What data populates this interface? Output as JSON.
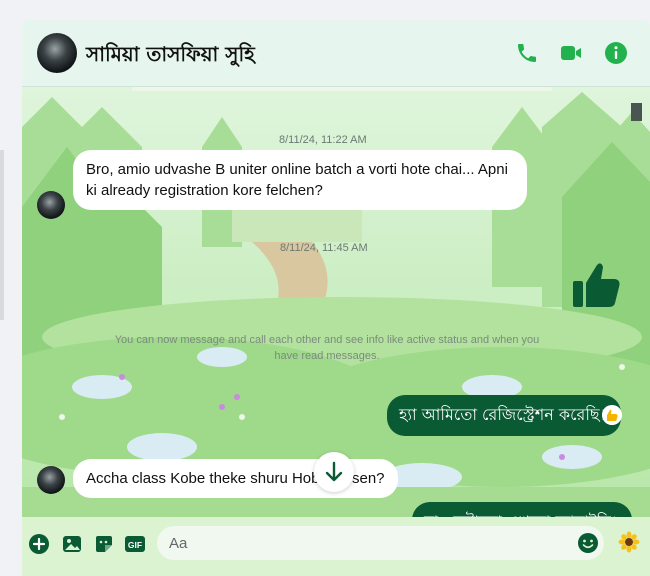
{
  "header": {
    "contact_name": "সামিয়া তাসফিয়া সুহি",
    "call_icon": "phone-icon",
    "video_icon": "video-camera-icon",
    "info_icon": "info-icon"
  },
  "messages": {
    "timestamp_1": "8/11/24, 11:22 AM",
    "incoming_1": "Bro, amio udvashe B uniter online batch a vorti hote chai... Apni ki already registration kore felchen?",
    "timestamp_2": "8/11/24, 11:45 AM",
    "outgoing_thumbs_icon": "thumbs-up-icon",
    "system_notice": "You can now message and call each other and see info like active status and when you have read messages.",
    "outgoing_1": "হ্যা আমিতো রেজিস্ট্রেশন করেছি।",
    "outgoing_1_reaction": "thumbs-up-icon",
    "incoming_2": "Accha class Kobe theke shuru Hobe jansen?",
    "outgoing_2": "না, সেটাতো এখনো জানাইনি।"
  },
  "composer": {
    "placeholder": "Aa",
    "icons": [
      "plus-circle-icon",
      "image-icon",
      "sticker-icon",
      "gif-icon",
      "emoji-icon",
      "sunflower-icon"
    ],
    "gif_label": "GIF"
  },
  "colors": {
    "accent": "#31a24c",
    "outgoing_bubble": "#0a5a34",
    "chat_background": "#cdeec5"
  }
}
